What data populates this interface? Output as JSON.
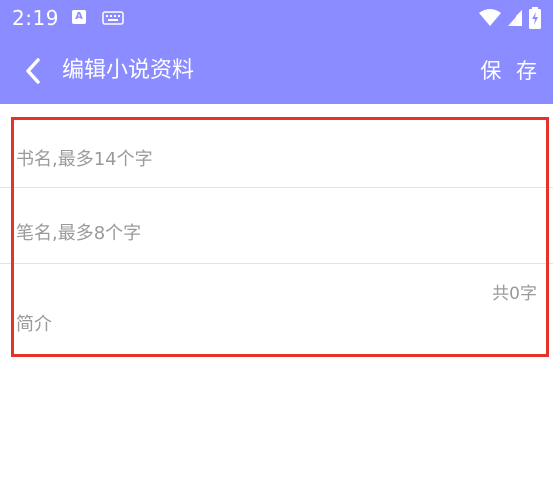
{
  "status_bar": {
    "time": "2:19",
    "notification_icon_letter": "A",
    "icons": [
      "notification-a-icon",
      "keyboard-icon",
      "wifi-icon",
      "signal-icon",
      "battery-charging-icon"
    ]
  },
  "app_bar": {
    "title": "编辑小说资料",
    "save_label": "保 存",
    "back_icon": "chevron-left-icon",
    "color": "#8b8cff"
  },
  "form": {
    "book_name_placeholder": "书名,最多14个字",
    "pen_name_placeholder": "笔名,最多8个字",
    "intro_placeholder": "简介",
    "intro_count": "共0字"
  },
  "highlight_color": "#e5332a"
}
